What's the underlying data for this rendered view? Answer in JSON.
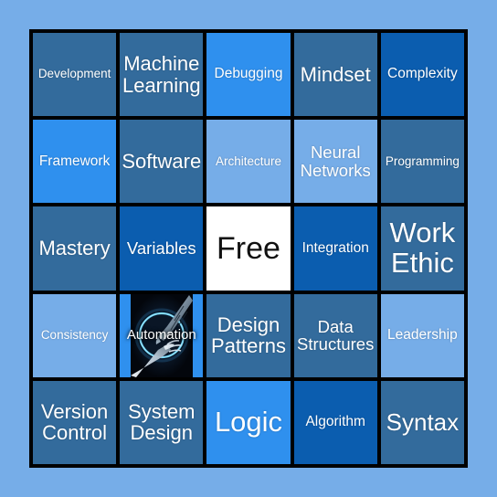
{
  "card": {
    "page_background": "#76ade8",
    "grid_line_color": "#000000",
    "palette": {
      "steel_blue": "#336b9c",
      "bright_blue": "#2f90ee",
      "deep_blue": "#0b5daf",
      "light_blue": "#76ade8",
      "white": "#ffffff"
    },
    "rows": 5,
    "columns": 5,
    "cells": [
      {
        "label": "Development",
        "bg": "#336b9c",
        "size": "fs-xs",
        "type": "text"
      },
      {
        "label": "Machine Learning",
        "bg": "#336b9c",
        "size": "fs-l",
        "type": "text"
      },
      {
        "label": "Debugging",
        "bg": "#2f90ee",
        "size": "fs-s",
        "type": "text"
      },
      {
        "label": "Mindset",
        "bg": "#336b9c",
        "size": "fs-l",
        "type": "text"
      },
      {
        "label": "Complexity",
        "bg": "#0b5daf",
        "size": "fs-s",
        "type": "text"
      },
      {
        "label": "Framework",
        "bg": "#2f90ee",
        "size": "fs-s",
        "type": "text"
      },
      {
        "label": "Software",
        "bg": "#336b9c",
        "size": "fs-l",
        "type": "text"
      },
      {
        "label": "Architecture",
        "bg": "#76ade8",
        "size": "fs-xs",
        "type": "text"
      },
      {
        "label": "Neural Networks",
        "bg": "#76ade8",
        "size": "fs-m",
        "type": "text"
      },
      {
        "label": "Programming",
        "bg": "#336b9c",
        "size": "fs-xs",
        "type": "text"
      },
      {
        "label": "Mastery",
        "bg": "#336b9c",
        "size": "fs-l",
        "type": "text"
      },
      {
        "label": "Variables",
        "bg": "#0b5daf",
        "size": "fs-m",
        "type": "text"
      },
      {
        "label": "Free",
        "bg": "#ffffff",
        "size": "fs-xxl",
        "type": "free"
      },
      {
        "label": "Integration",
        "bg": "#0b5daf",
        "size": "fs-s",
        "type": "text"
      },
      {
        "label": "Work Ethic",
        "bg": "#336b9c",
        "size": "fs-xxl",
        "type": "text"
      },
      {
        "label": "Consistency",
        "bg": "#76ade8",
        "size": "fs-xs",
        "type": "text"
      },
      {
        "label": "Automation",
        "bg": "#2f90ee",
        "size": "fs-s",
        "type": "image",
        "image": "robot-human-hands-photo"
      },
      {
        "label": "Design Patterns",
        "bg": "#336b9c",
        "size": "fs-l",
        "type": "text"
      },
      {
        "label": "Data Structures",
        "bg": "#336b9c",
        "size": "fs-m",
        "type": "text"
      },
      {
        "label": "Leadership",
        "bg": "#76ade8",
        "size": "fs-s",
        "type": "text"
      },
      {
        "label": "Version Control",
        "bg": "#336b9c",
        "size": "fs-l",
        "type": "text"
      },
      {
        "label": "System Design",
        "bg": "#336b9c",
        "size": "fs-l",
        "type": "text"
      },
      {
        "label": "Logic",
        "bg": "#2f90ee",
        "size": "fs-xxl",
        "type": "text"
      },
      {
        "label": "Algorithm",
        "bg": "#0b5daf",
        "size": "fs-s",
        "type": "text"
      },
      {
        "label": "Syntax",
        "bg": "#336b9c",
        "size": "fs-xl",
        "type": "text"
      }
    ]
  }
}
